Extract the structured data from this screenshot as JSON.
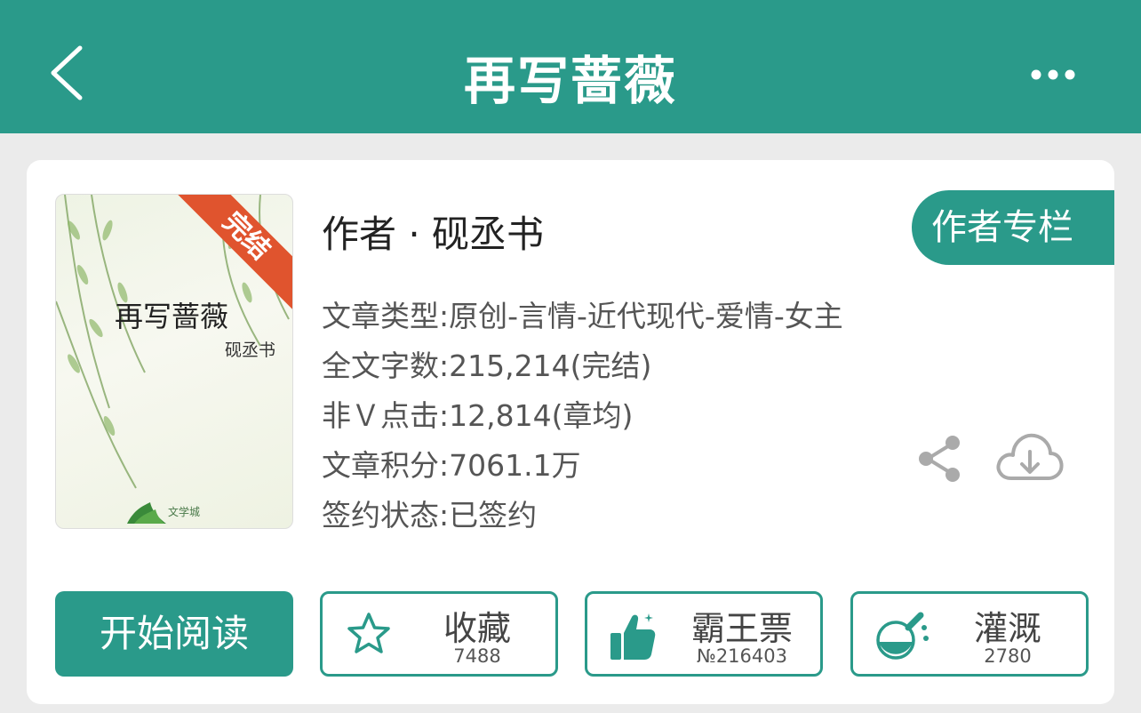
{
  "header": {
    "title": "再写蔷薇"
  },
  "book": {
    "cover": {
      "title": "再写蔷薇",
      "author": "砚丞书",
      "ribbon": "完结",
      "publisher": "文学城"
    },
    "author_line": "作者 · 砚丞书",
    "author_column_label": "作者专栏",
    "info": [
      "文章类型:原创-言情-近代现代-爱情-女主",
      "全文字数:215,214(完结)",
      "非Ｖ点击:12,814(章均)",
      "文章积分:7061.1万",
      "签约状态:已签约"
    ]
  },
  "actions": {
    "read": "开始阅读",
    "collect": {
      "label": "收藏",
      "count": "7488"
    },
    "vote": {
      "label": "霸王票",
      "count": "№216403"
    },
    "water": {
      "label": "灌溉",
      "count": "2780"
    }
  },
  "colors": {
    "accent": "#2a9a8a",
    "ribbon": "#e0542e",
    "background": "#ebebeb"
  },
  "icons": [
    "back-icon",
    "more-icon",
    "share-icon",
    "download-icon",
    "star-icon",
    "thumbs-up-icon",
    "flask-icon"
  ]
}
